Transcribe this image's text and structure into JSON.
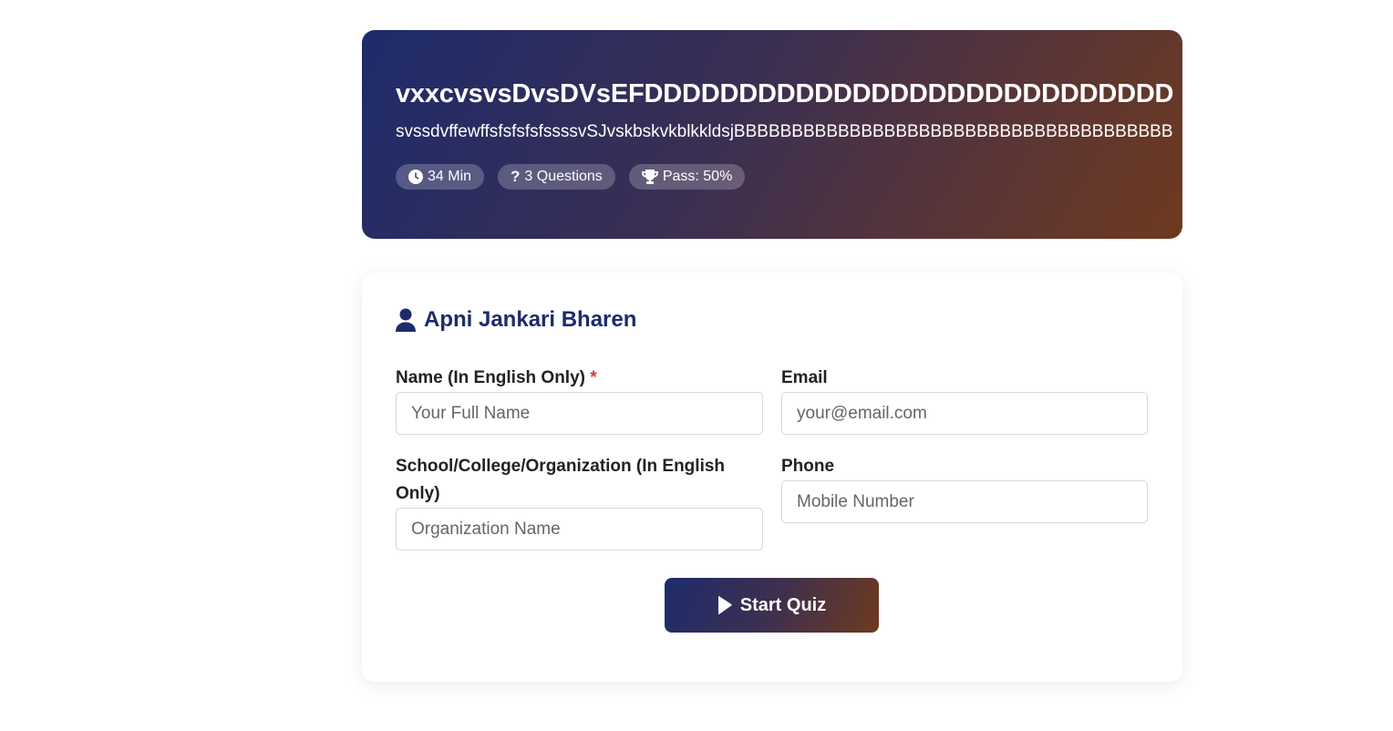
{
  "hero": {
    "title": "vxxcvsvsDvsDVsEFDDDDDDDDDDDDDDDDDDDDDDDDDDDD",
    "description": "svssdvffewffsfsfsfsfssssvSJvskbskvkblkkldsjBBBBBBBBBBBBBBBBBBBBBBBBBBBBBBBBBBBBBB",
    "badges": {
      "time": "34 Min",
      "questions": "3 Questions",
      "pass": "Pass: 50%"
    }
  },
  "form": {
    "heading": "Apni Jankari Bharen",
    "name_label": "Name (In English Only)",
    "name_required": "*",
    "name_placeholder": "Your Full Name",
    "email_label": "Email",
    "email_placeholder": "your@email.com",
    "org_label": "School/College/Organization (In English Only)",
    "org_placeholder": "Organization Name",
    "phone_label": "Phone",
    "phone_placeholder": "Mobile Number",
    "submit_label": "Start Quiz"
  },
  "colors": {
    "primary": "#1e2b6b",
    "accent": "#6e3a1f",
    "required": "#d33a3a"
  },
  "icons": [
    "clock-icon",
    "question-icon",
    "trophy-icon",
    "user-icon",
    "play-icon"
  ]
}
